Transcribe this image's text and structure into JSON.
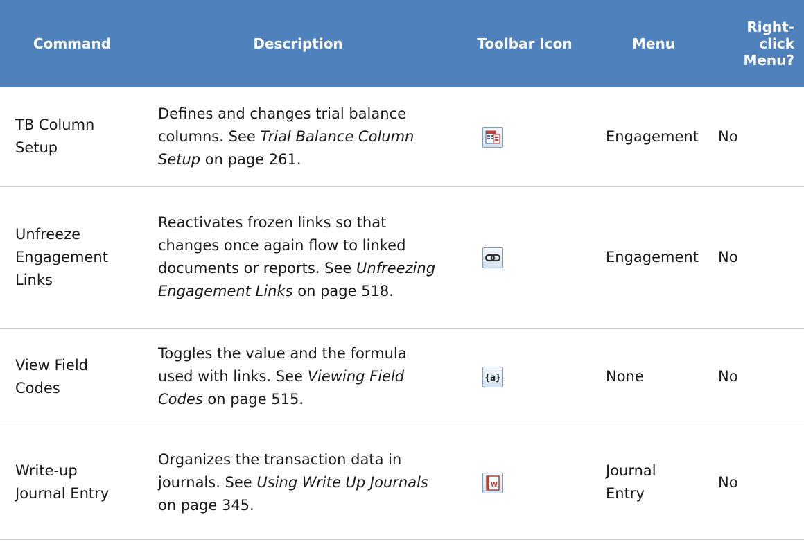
{
  "headers": {
    "command": "Command",
    "description": "Description",
    "toolbar_icon": "Toolbar Icon",
    "menu": "Menu",
    "right_click_line1": "Right-",
    "right_click_line2": "click",
    "right_click_line3": "Menu?"
  },
  "rows": [
    {
      "command_line1": "TB Column",
      "command_line2": "Setup",
      "desc_prefix": "Defines and changes trial balance columns. See ",
      "desc_link": "Trial Balance Column Setup",
      "desc_suffix": " on page 261.",
      "icon": "tb-column-setup-icon",
      "menu": "Engagement",
      "right_click": "No"
    },
    {
      "command_line1": "Unfreeze",
      "command_line2": "Engagement",
      "command_line3": "Links",
      "desc_prefix": "Reactivates frozen links so that changes once again flow to linked documents or reports. See ",
      "desc_link": "Unfreezing Engagement Links",
      "desc_suffix": " on page 518.",
      "icon": "chain-link-icon",
      "menu": "Engagement",
      "right_click": "No"
    },
    {
      "command_line1": "View Field",
      "command_line2": "Codes",
      "desc_prefix": "Toggles the value and the formula used with links. See ",
      "desc_link": "Viewing Field Codes",
      "desc_suffix": " on page 515.",
      "icon": "field-codes-icon",
      "icon_text": "{a}",
      "menu": "None",
      "right_click": "No"
    },
    {
      "command_line1": "Write-up",
      "command_line2": "Journal Entry",
      "desc_prefix": "Organizes the transaction data in journals. See ",
      "desc_link": "Using Write Up Journals",
      "desc_suffix": " on page 345.",
      "icon": "write-up-journal-icon",
      "icon_text": "W",
      "menu_line1": "Journal",
      "menu_line2": "Entry",
      "right_click": "No"
    }
  ]
}
